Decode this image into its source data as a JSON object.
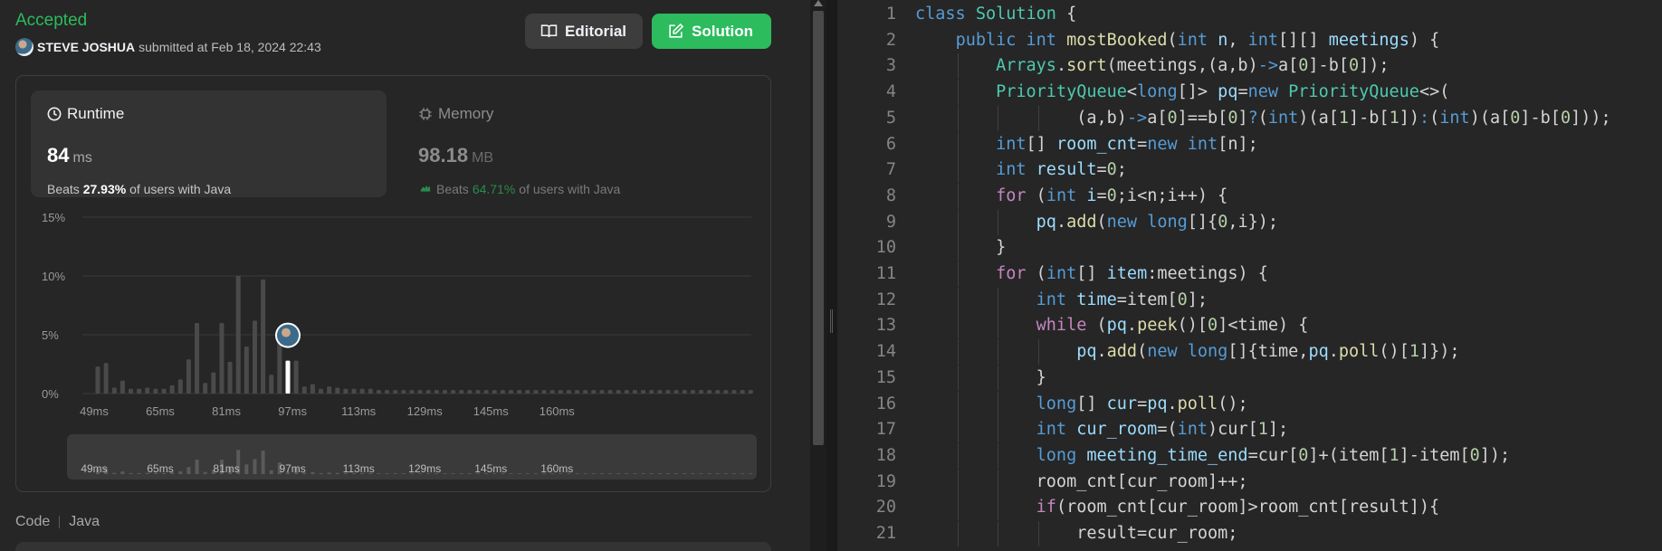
{
  "submission": {
    "status": "Accepted",
    "user": "STEVE JOSHUA",
    "submitted_text": "submitted at Feb 18, 2024 22:43",
    "editorial_label": "Editorial",
    "solution_label": "Solution"
  },
  "runtime": {
    "label": "Runtime",
    "value": "84",
    "unit": "ms",
    "beats_prefix": "Beats",
    "beats_pct": "27.93%",
    "beats_suffix": "of users with Java"
  },
  "memory": {
    "label": "Memory",
    "value": "98.18",
    "unit": "MB",
    "beats_prefix": "Beats",
    "beats_pct": "64.71%",
    "beats_suffix": "of users with Java"
  },
  "chart_data": {
    "type": "bar",
    "title": "",
    "xlabel": "",
    "ylabel": "",
    "yticks": [
      "0%",
      "5%",
      "10%",
      "15%"
    ],
    "ylim": [
      0,
      15
    ],
    "xticks": [
      "49ms",
      "65ms",
      "81ms",
      "97ms",
      "113ms",
      "129ms",
      "145ms",
      "160ms"
    ],
    "x_start_ms": 49,
    "bin_ms": 2,
    "values": [
      2.3,
      2.6,
      0.5,
      1.1,
      0.4,
      0.4,
      0.5,
      0.4,
      0.4,
      0.7,
      1.2,
      2.9,
      6.0,
      0.9,
      1.8,
      6.0,
      2.7,
      10.0,
      4.0,
      6.2,
      9.7,
      1.6,
      4.8,
      0.8,
      2.8,
      0.6,
      0.8,
      0.4,
      0.6,
      0.5,
      0.4,
      0.4,
      0.4,
      0.4,
      0.3,
      0.3,
      0.3,
      0.3,
      0.3,
      0.3,
      0.3,
      0.3,
      0.3,
      0.3,
      0.3,
      0.3,
      0.3,
      0.3,
      0.3,
      0.3,
      0.3,
      0.3,
      0.3,
      0.3,
      0.3,
      0.3,
      0.3,
      0.3,
      0.3,
      0.3,
      0.3,
      0.3,
      0.3,
      0.3,
      0.3,
      0.3,
      0.3,
      0.3,
      0.3,
      0.3,
      0.3,
      0.3,
      0.3,
      0.3,
      0.3,
      0.3,
      0.3,
      0.3,
      0.3,
      0.3
    ],
    "highlight_index": 23,
    "highlight_value": 2.8,
    "grid": true,
    "colors": {
      "bar": "#4a4a4a",
      "highlight": "#ffffff",
      "grid": "#3a3a3a",
      "tick": "#9a9a9a"
    }
  },
  "code_section": {
    "label": "Code",
    "language": "Java"
  },
  "editor": {
    "lines": [
      {
        "n": "1",
        "tokens": [
          [
            "k",
            "class"
          ],
          [
            "p",
            " "
          ],
          [
            "t",
            "Solution"
          ],
          [
            "p",
            " {"
          ]
        ]
      },
      {
        "n": "2",
        "tokens": [
          [
            "p",
            "    "
          ],
          [
            "k",
            "public"
          ],
          [
            "p",
            " "
          ],
          [
            "k",
            "int"
          ],
          [
            "p",
            " "
          ],
          [
            "f",
            "mostBooked"
          ],
          [
            "p",
            "("
          ],
          [
            "k",
            "int"
          ],
          [
            "p",
            " "
          ],
          [
            "v",
            "n"
          ],
          [
            "p",
            ", "
          ],
          [
            "k",
            "int"
          ],
          [
            "p",
            "[][] "
          ],
          [
            "v",
            "meetings"
          ],
          [
            "p",
            ") {"
          ]
        ]
      },
      {
        "n": "3",
        "tokens": [
          [
            "p",
            "        "
          ],
          [
            "t",
            "Arrays"
          ],
          [
            "p",
            "."
          ],
          [
            "f",
            "sort"
          ],
          [
            "p",
            "(meetings,(a,b)"
          ],
          [
            "k",
            "->"
          ],
          [
            "p",
            "a["
          ],
          [
            "n",
            "0"
          ],
          [
            "p",
            "]-b["
          ],
          [
            "n",
            "0"
          ],
          [
            "p",
            "]);"
          ]
        ]
      },
      {
        "n": "4",
        "tokens": [
          [
            "p",
            "        "
          ],
          [
            "t",
            "PriorityQueue"
          ],
          [
            "p",
            "<"
          ],
          [
            "k",
            "long"
          ],
          [
            "p",
            "[]> "
          ],
          [
            "v",
            "pq"
          ],
          [
            "p",
            "="
          ],
          [
            "k",
            "new"
          ],
          [
            "p",
            " "
          ],
          [
            "t",
            "PriorityQueue"
          ],
          [
            "p",
            "<>("
          ]
        ]
      },
      {
        "n": "5",
        "tokens": [
          [
            "p",
            "                (a,b)"
          ],
          [
            "k",
            "->"
          ],
          [
            "p",
            "a["
          ],
          [
            "n",
            "0"
          ],
          [
            "p",
            "]==b["
          ],
          [
            "n",
            "0"
          ],
          [
            "p",
            "]"
          ],
          [
            "k",
            "?"
          ],
          [
            "p",
            "("
          ],
          [
            "k",
            "int"
          ],
          [
            "p",
            ")(a["
          ],
          [
            "n",
            "1"
          ],
          [
            "p",
            "]-b["
          ],
          [
            "n",
            "1"
          ],
          [
            "p",
            "])"
          ],
          [
            "k",
            ":"
          ],
          [
            "p",
            "("
          ],
          [
            "k",
            "int"
          ],
          [
            "p",
            ")(a["
          ],
          [
            "n",
            "0"
          ],
          [
            "p",
            "]-b["
          ],
          [
            "n",
            "0"
          ],
          [
            "p",
            "]));"
          ]
        ]
      },
      {
        "n": "6",
        "tokens": [
          [
            "p",
            "        "
          ],
          [
            "k",
            "int"
          ],
          [
            "p",
            "[] "
          ],
          [
            "v",
            "room_cnt"
          ],
          [
            "p",
            "="
          ],
          [
            "k",
            "new"
          ],
          [
            "p",
            " "
          ],
          [
            "k",
            "int"
          ],
          [
            "p",
            "[n];"
          ]
        ]
      },
      {
        "n": "7",
        "tokens": [
          [
            "p",
            "        "
          ],
          [
            "k",
            "int"
          ],
          [
            "p",
            " "
          ],
          [
            "v",
            "result"
          ],
          [
            "p",
            "="
          ],
          [
            "n",
            "0"
          ],
          [
            "p",
            ";"
          ]
        ]
      },
      {
        "n": "8",
        "tokens": [
          [
            "p",
            "        "
          ],
          [
            "ctl",
            "for"
          ],
          [
            "p",
            " ("
          ],
          [
            "k",
            "int"
          ],
          [
            "p",
            " "
          ],
          [
            "v",
            "i"
          ],
          [
            "p",
            "="
          ],
          [
            "n",
            "0"
          ],
          [
            "p",
            ";i<n;i++) {"
          ]
        ]
      },
      {
        "n": "9",
        "tokens": [
          [
            "p",
            "            "
          ],
          [
            "v",
            "pq"
          ],
          [
            "p",
            "."
          ],
          [
            "f",
            "add"
          ],
          [
            "p",
            "("
          ],
          [
            "k",
            "new"
          ],
          [
            "p",
            " "
          ],
          [
            "k",
            "long"
          ],
          [
            "p",
            "[]{"
          ],
          [
            "n",
            "0"
          ],
          [
            "p",
            ",i});"
          ]
        ]
      },
      {
        "n": "10",
        "tokens": [
          [
            "p",
            "        }"
          ]
        ]
      },
      {
        "n": "11",
        "tokens": [
          [
            "p",
            "        "
          ],
          [
            "ctl",
            "for"
          ],
          [
            "p",
            " ("
          ],
          [
            "k",
            "int"
          ],
          [
            "p",
            "[] "
          ],
          [
            "v",
            "item"
          ],
          [
            "p",
            ":meetings) {"
          ]
        ]
      },
      {
        "n": "12",
        "tokens": [
          [
            "p",
            "            "
          ],
          [
            "k",
            "int"
          ],
          [
            "p",
            " "
          ],
          [
            "v",
            "time"
          ],
          [
            "p",
            "=item["
          ],
          [
            "n",
            "0"
          ],
          [
            "p",
            "];"
          ]
        ]
      },
      {
        "n": "13",
        "tokens": [
          [
            "p",
            "            "
          ],
          [
            "ctl",
            "while"
          ],
          [
            "p",
            " ("
          ],
          [
            "v",
            "pq"
          ],
          [
            "p",
            "."
          ],
          [
            "f",
            "peek"
          ],
          [
            "p",
            "()["
          ],
          [
            "n",
            "0"
          ],
          [
            "p",
            "]<time) {"
          ]
        ]
      },
      {
        "n": "14",
        "tokens": [
          [
            "p",
            "                "
          ],
          [
            "v",
            "pq"
          ],
          [
            "p",
            "."
          ],
          [
            "f",
            "add"
          ],
          [
            "p",
            "("
          ],
          [
            "k",
            "new"
          ],
          [
            "p",
            " "
          ],
          [
            "k",
            "long"
          ],
          [
            "p",
            "[]{time,"
          ],
          [
            "v",
            "pq"
          ],
          [
            "p",
            "."
          ],
          [
            "f",
            "poll"
          ],
          [
            "p",
            "()["
          ],
          [
            "n",
            "1"
          ],
          [
            "p",
            "]});"
          ]
        ]
      },
      {
        "n": "15",
        "tokens": [
          [
            "p",
            "            }"
          ]
        ]
      },
      {
        "n": "16",
        "tokens": [
          [
            "p",
            "            "
          ],
          [
            "k",
            "long"
          ],
          [
            "p",
            "[] "
          ],
          [
            "v",
            "cur"
          ],
          [
            "p",
            "="
          ],
          [
            "v",
            "pq"
          ],
          [
            "p",
            "."
          ],
          [
            "f",
            "poll"
          ],
          [
            "p",
            "();"
          ]
        ]
      },
      {
        "n": "17",
        "tokens": [
          [
            "p",
            "            "
          ],
          [
            "k",
            "int"
          ],
          [
            "p",
            " "
          ],
          [
            "v",
            "cur_room"
          ],
          [
            "p",
            "=("
          ],
          [
            "k",
            "int"
          ],
          [
            "p",
            ")cur["
          ],
          [
            "n",
            "1"
          ],
          [
            "p",
            "];"
          ]
        ]
      },
      {
        "n": "18",
        "tokens": [
          [
            "p",
            "            "
          ],
          [
            "k",
            "long"
          ],
          [
            "p",
            " "
          ],
          [
            "v",
            "meeting_time_end"
          ],
          [
            "p",
            "=cur["
          ],
          [
            "n",
            "0"
          ],
          [
            "p",
            "]+(item["
          ],
          [
            "n",
            "1"
          ],
          [
            "p",
            "]-item["
          ],
          [
            "n",
            "0"
          ],
          [
            "p",
            "]);"
          ]
        ]
      },
      {
        "n": "19",
        "tokens": [
          [
            "p",
            "            room_cnt[cur_room]++;"
          ]
        ]
      },
      {
        "n": "20",
        "tokens": [
          [
            "p",
            "            "
          ],
          [
            "ctl",
            "if"
          ],
          [
            "p",
            "(room_cnt[cur_room]>room_cnt[result]){"
          ]
        ]
      },
      {
        "n": "21",
        "tokens": [
          [
            "p",
            "                result=cur_room;"
          ]
        ]
      }
    ]
  }
}
